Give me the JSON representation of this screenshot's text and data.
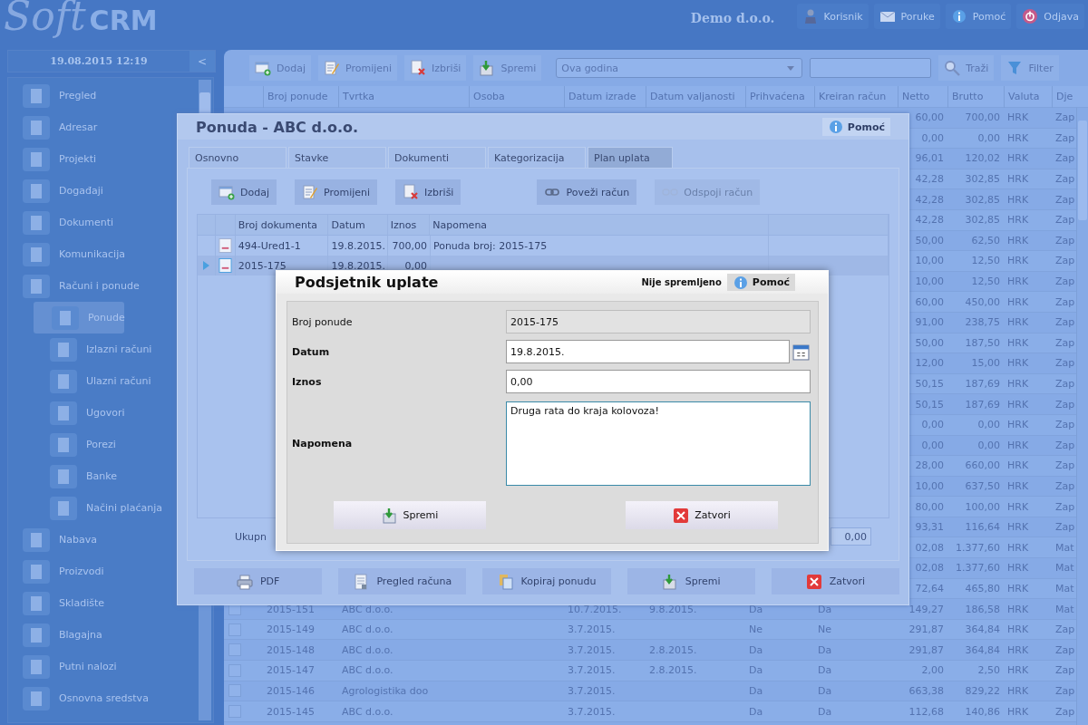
{
  "header": {
    "logo_light": "Soft",
    "logo_bold": "CRM",
    "company": "Demo d.o.o.",
    "buttons": [
      "Korisnik",
      "Poruke",
      "Pomoć",
      "Odjava"
    ]
  },
  "sidebar": {
    "datetime": "19.08.2015 12:19",
    "collapse": "<",
    "items": [
      {
        "label": "Pregled",
        "selected": false
      },
      {
        "label": "Adresar",
        "selected": false
      },
      {
        "label": "Projekti",
        "selected": false
      },
      {
        "label": "Događaji",
        "selected": false
      },
      {
        "label": "Dokumenti",
        "selected": false
      },
      {
        "label": "Komunikacija",
        "selected": false
      },
      {
        "label": "Računi i ponude",
        "selected": false,
        "expanded": true,
        "children": [
          {
            "label": "Ponude",
            "selected": true
          },
          {
            "label": "Izlazni računi",
            "selected": false
          },
          {
            "label": "Ulazni računi",
            "selected": false
          },
          {
            "label": "Ugovori",
            "selected": false
          },
          {
            "label": "Porezi",
            "selected": false
          },
          {
            "label": "Banke",
            "selected": false
          },
          {
            "label": "Načini plaćanja",
            "selected": false
          }
        ]
      },
      {
        "label": "Nabava",
        "selected": false
      },
      {
        "label": "Proizvodi",
        "selected": false
      },
      {
        "label": "Skladište",
        "selected": false
      },
      {
        "label": "Blagajna",
        "selected": false
      },
      {
        "label": "Putni nalozi",
        "selected": false
      },
      {
        "label": "Osnovna sredstva",
        "selected": false
      }
    ]
  },
  "toolbar": {
    "buttons": [
      "Dodaj",
      "Promijeni",
      "Izbriši",
      "Spremi"
    ],
    "period": "Ova godina",
    "actions": [
      "Traži",
      "Filter"
    ]
  },
  "table": {
    "columns": [
      "Broj ponude",
      "Tvrtka",
      "Osoba",
      "Datum izrade",
      "Datum valjanosti",
      "Prihvaćena",
      "Kreiran račun",
      "Netto",
      "Brutto",
      "Valuta",
      "Dje"
    ],
    "rows": [
      {
        "netto": "60,00",
        "brutto": "700,00",
        "valuta": "HRK",
        "dje": "Zap"
      },
      {
        "netto": "0,00",
        "brutto": "0,00",
        "valuta": "HRK",
        "dje": "Zap"
      },
      {
        "netto": "96,01",
        "brutto": "120,02",
        "valuta": "HRK",
        "dje": "Zap"
      },
      {
        "netto": "42,28",
        "brutto": "302,85",
        "valuta": "HRK",
        "dje": "Zap"
      },
      {
        "netto": "42,28",
        "brutto": "302,85",
        "valuta": "HRK",
        "dje": "Zap"
      },
      {
        "netto": "42,28",
        "brutto": "302,85",
        "valuta": "HRK",
        "dje": "Zap"
      },
      {
        "netto": "50,00",
        "brutto": "62,50",
        "valuta": "HRK",
        "dje": "Zap"
      },
      {
        "netto": "10,00",
        "brutto": "12,50",
        "valuta": "HRK",
        "dje": "Zap"
      },
      {
        "netto": "10,00",
        "brutto": "12,50",
        "valuta": "HRK",
        "dje": "Zap"
      },
      {
        "netto": "60,00",
        "brutto": "450,00",
        "valuta": "HRK",
        "dje": "Zap"
      },
      {
        "netto": "91,00",
        "brutto": "238,75",
        "valuta": "HRK",
        "dje": "Zap"
      },
      {
        "netto": "50,00",
        "brutto": "187,50",
        "valuta": "HRK",
        "dje": "Zap"
      },
      {
        "netto": "12,00",
        "brutto": "15,00",
        "valuta": "HRK",
        "dje": "Zap"
      },
      {
        "netto": "50,15",
        "brutto": "187,69",
        "valuta": "HRK",
        "dje": "Zap"
      },
      {
        "netto": "50,15",
        "brutto": "187,69",
        "valuta": "HRK",
        "dje": "Zap"
      },
      {
        "netto": "0,00",
        "brutto": "0,00",
        "valuta": "HRK",
        "dje": "Zap"
      },
      {
        "netto": "0,00",
        "brutto": "0,00",
        "valuta": "HRK",
        "dje": "Zap"
      },
      {
        "netto": "28,00",
        "brutto": "660,00",
        "valuta": "HRK",
        "dje": "Zap"
      },
      {
        "netto": "10,00",
        "brutto": "637,50",
        "valuta": "HRK",
        "dje": "Zap"
      },
      {
        "netto": "80,00",
        "brutto": "100,00",
        "valuta": "HRK",
        "dje": "Zap"
      },
      {
        "netto": "93,31",
        "brutto": "116,64",
        "valuta": "HRK",
        "dje": "Zap"
      },
      {
        "netto": "02,08",
        "brutto": "1.377,60",
        "valuta": "HRK",
        "dje": "Mat"
      },
      {
        "netto": "02,08",
        "brutto": "1.377,60",
        "valuta": "HRK",
        "dje": "Mat"
      },
      {
        "netto": "72,64",
        "brutto": "465,80",
        "valuta": "HRK",
        "dje": "Mat"
      },
      {
        "checked": false,
        "broj": "2015-151",
        "tvrtka": "ABC d.o.o.",
        "datum_izrade": "10.7.2015.",
        "datum_valjanosti": "9.8.2015.",
        "prihvacena": "Da",
        "kreiran": "Da",
        "netto": "149,27",
        "brutto": "186,58",
        "valuta": "HRK",
        "dje": "Mat"
      },
      {
        "checked": false,
        "broj": "2015-149",
        "tvrtka": "ABC d.o.o.",
        "datum_izrade": "3.7.2015.",
        "prihvacena": "Ne",
        "kreiran": "Ne",
        "netto": "291,87",
        "brutto": "364,84",
        "valuta": "HRK",
        "dje": "Zap"
      },
      {
        "checked": false,
        "broj": "2015-148",
        "tvrtka": "ABC d.o.o.",
        "datum_izrade": "3.7.2015.",
        "datum_valjanosti": "2.8.2015.",
        "prihvacena": "Da",
        "kreiran": "Da",
        "netto": "291,87",
        "brutto": "364,84",
        "valuta": "HRK",
        "dje": "Zap"
      },
      {
        "checked": false,
        "broj": "2015-147",
        "tvrtka": "ABC d.o.o.",
        "datum_izrade": "3.7.2015.",
        "datum_valjanosti": "2.8.2015.",
        "prihvacena": "Da",
        "kreiran": "Da",
        "netto": "2,00",
        "brutto": "2,50",
        "valuta": "HRK",
        "dje": "Zap"
      },
      {
        "checked": false,
        "broj": "2015-146",
        "tvrtka": "Agrologistika doo",
        "datum_izrade": "3.7.2015.",
        "prihvacena": "Da",
        "kreiran": "Da",
        "netto": "663,38",
        "brutto": "829,22",
        "valuta": "HRK",
        "dje": "Zap"
      },
      {
        "checked": false,
        "broj": "2015-145",
        "tvrtka": "ABC d.o.o.",
        "datum_izrade": "3.7.2015.",
        "prihvacena": "Da",
        "kreiran": "Da",
        "netto": "112,68",
        "brutto": "140,86",
        "valuta": "HRK",
        "dje": "Zap"
      }
    ]
  },
  "offer_dialog": {
    "title": "Ponuda - ABC d.o.o.",
    "help": "Pomoć",
    "tabs": [
      {
        "label": "Osnovno",
        "selected": false
      },
      {
        "label": "Stavke",
        "selected": false
      },
      {
        "label": "Dokumenti",
        "selected": false
      },
      {
        "label": "Kategorizacija",
        "selected": false
      },
      {
        "label": "Plan uplata",
        "selected": true
      }
    ],
    "buttons": [
      {
        "label": "Dodaj",
        "disabled": false
      },
      {
        "label": "Promijeni",
        "disabled": false
      },
      {
        "label": "Izbriši",
        "disabled": false
      },
      {
        "label": "Poveži račun",
        "disabled": false
      },
      {
        "label": "Odspoji račun",
        "disabled": true
      }
    ],
    "grid": {
      "columns": [
        "Broj dokumenta",
        "Datum",
        "Iznos",
        "Napomena"
      ],
      "rows": [
        {
          "selected": false,
          "doc": "494-Ured1-1",
          "datum": "19.8.2015.",
          "iznos": "700,00",
          "napomena": "Ponuda broj: 2015-175"
        },
        {
          "selected": true,
          "doc": "2015-175",
          "datum": "19.8.2015.",
          "iznos": "0,00"
        }
      ]
    },
    "total_label": "Ukupn",
    "total": "0,00",
    "footer_buttons": [
      "PDF",
      "Pregled računa",
      "Kopiraj ponudu",
      "Spremi",
      "Zatvori"
    ]
  },
  "reminder_dialog": {
    "title": "Podsjetnik uplate",
    "status": "Nije spremljeno",
    "help": "Pomoć",
    "fields": [
      {
        "kind": "text",
        "label": "Broj ponude",
        "required": false,
        "readonly": true,
        "value": "2015-175"
      },
      {
        "kind": "date",
        "label": "Datum",
        "required": true,
        "readonly": false,
        "value": "19.8.2015."
      },
      {
        "kind": "text",
        "label": "Iznos",
        "required": true,
        "readonly": false,
        "value": "0,00"
      },
      {
        "kind": "textarea",
        "label": "Napomena",
        "required": true,
        "readonly": false,
        "value": "Druga rata do kraja kolovoza!"
      }
    ],
    "buttons": [
      "Spremi",
      "Zatvori"
    ]
  }
}
